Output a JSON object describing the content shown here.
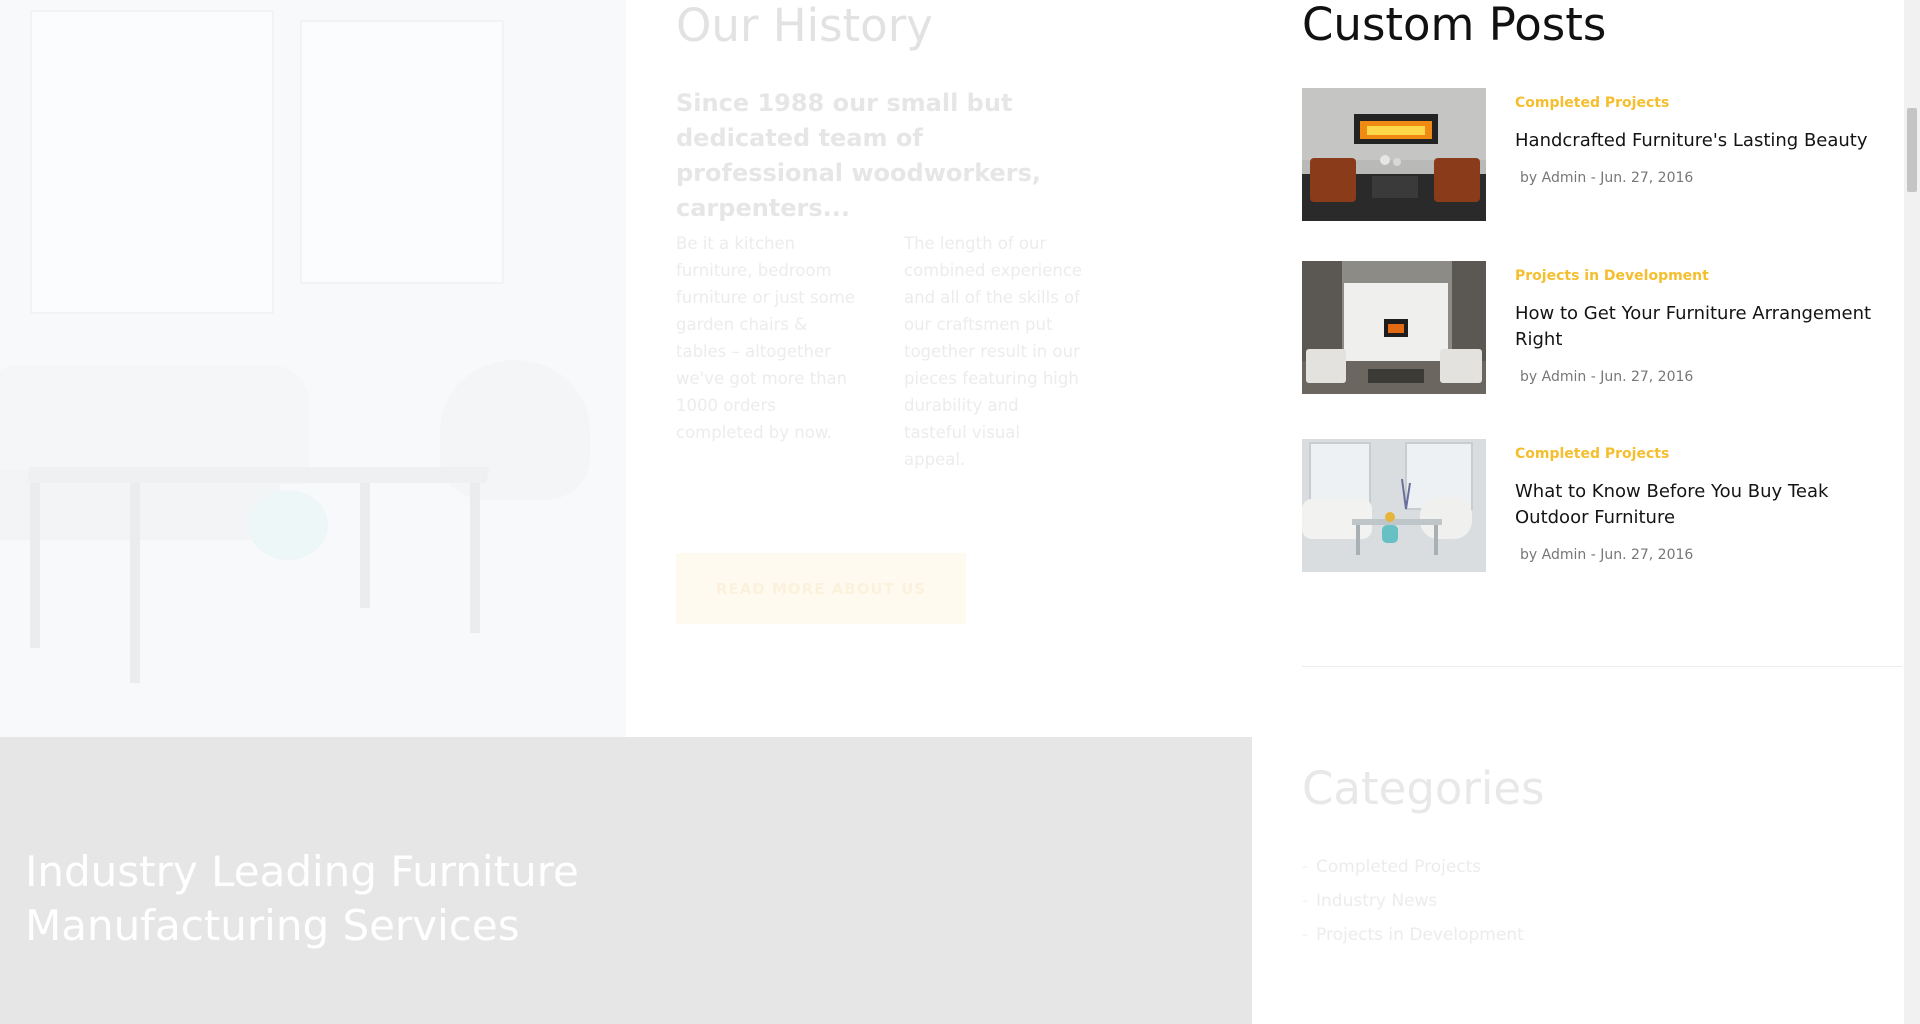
{
  "history": {
    "title": "Our History",
    "lead": "Since 1988 our small but dedicated team of professional woodworkers, carpenters...",
    "col1": "Be it a kitchen furniture, bedroom furniture or just some garden chairs & tables – altogether we've got more than 1000 orders completed by now.",
    "col2": "The length of our combined experience and all of the skills of our craftsmen put together result in our pieces featuring high durability and tasteful visual appeal.",
    "button_label": "READ MORE ABOUT US"
  },
  "services": {
    "title_line1": "Industry Leading Furniture",
    "title_line2": "Manufacturing Services"
  },
  "sidebar": {
    "posts_title": "Custom Posts",
    "posts": [
      {
        "category": "Completed Projects",
        "title": "Handcrafted Furniture's Lasting Beauty",
        "meta": "by Admin - Jun. 27, 2016"
      },
      {
        "category": "Projects in Development",
        "title": "How to Get Your Furniture Arrangement Right",
        "meta": "by Admin - Jun. 27, 2016"
      },
      {
        "category": "Completed Projects",
        "title": "What to Know Before You Buy Teak Outdoor Furniture",
        "meta": "by Admin - Jun. 27, 2016"
      }
    ],
    "categories_title": "Categories",
    "categories": [
      "Completed Projects",
      "Industry News",
      "Projects in Development"
    ]
  },
  "colors": {
    "accent": "#f5be2e",
    "band": "#e6e6e6",
    "heading": "#111111"
  },
  "icons": [
    "bullet-dash-icon"
  ]
}
